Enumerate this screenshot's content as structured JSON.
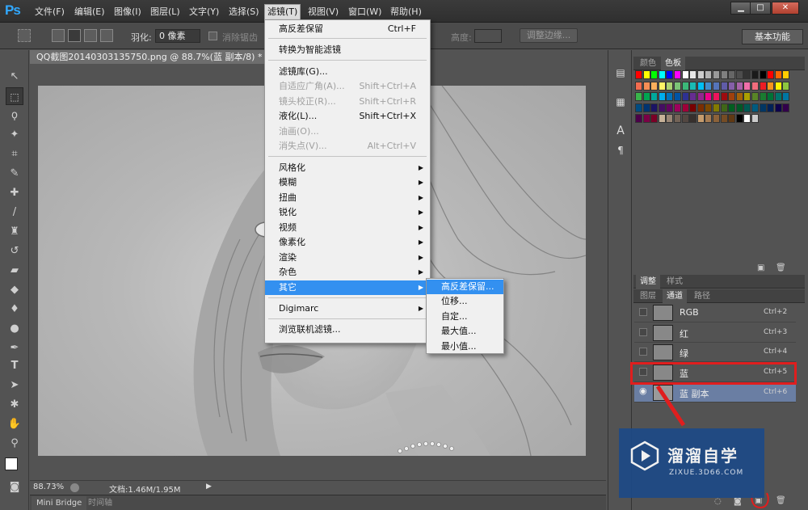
{
  "app": {
    "logo": "Ps",
    "menu": [
      {
        "label": "文件(F)"
      },
      {
        "label": "编辑(E)"
      },
      {
        "label": "图像(I)"
      },
      {
        "label": "图层(L)"
      },
      {
        "label": "文字(Y)"
      },
      {
        "label": "选择(S)"
      },
      {
        "label": "滤镜(T)"
      },
      {
        "label": "视图(V)"
      },
      {
        "label": "窗口(W)"
      },
      {
        "label": "帮助(H)"
      }
    ],
    "window_controls": {
      "minimize": "▁",
      "maximize": "□",
      "close": "✕"
    }
  },
  "options": {
    "feather_label": "羽化:",
    "feather_value": "0 像素",
    "antialias_label": "消除锯齿",
    "height_label": "高度:",
    "refine_edge_label": "调整边缘...",
    "workspace": "基本功能"
  },
  "document": {
    "tab_title": "QQ截图20140303135750.png @ 88.7%(蓝 副本/8) *",
    "tab_close": "×",
    "zoom": "88.73%",
    "doc_size": "文档:1.46M/1.95M"
  },
  "bottom_tabs": {
    "mini_bridge": "Mini Bridge",
    "timeline": "时间轴"
  },
  "filter_menu": {
    "items": [
      {
        "label": "高反差保留",
        "shortcut": "Ctrl+F"
      },
      {
        "label": "转换为智能滤镜"
      },
      {
        "label": "滤镜库(G)..."
      },
      {
        "label": "自适应广角(A)...",
        "shortcut": "Shift+Ctrl+A",
        "disabled": true
      },
      {
        "label": "镜头校正(R)...",
        "shortcut": "Shift+Ctrl+R",
        "disabled": true
      },
      {
        "label": "液化(L)...",
        "shortcut": "Shift+Ctrl+X"
      },
      {
        "label": "油画(O)...",
        "disabled": true
      },
      {
        "label": "消失点(V)...",
        "shortcut": "Alt+Ctrl+V",
        "disabled": true
      },
      {
        "label": "风格化"
      },
      {
        "label": "模糊"
      },
      {
        "label": "扭曲"
      },
      {
        "label": "锐化"
      },
      {
        "label": "视频"
      },
      {
        "label": "像素化"
      },
      {
        "label": "渲染"
      },
      {
        "label": "杂色"
      },
      {
        "label": "其它"
      },
      {
        "label": "Digimarc"
      },
      {
        "label": "浏览联机滤镜..."
      }
    ],
    "submenu": [
      "高反差保留...",
      "位移...",
      "自定...",
      "最大值...",
      "最小值..."
    ]
  },
  "panels": {
    "color_tabs": {
      "color": "颜色",
      "swatches": "色板"
    },
    "adjust_tabs": {
      "adjust": "调整",
      "styles": "样式"
    },
    "layer_tabs": {
      "layers": "图层",
      "channels": "通道",
      "paths": "路径"
    },
    "channels": [
      {
        "name": "RGB",
        "key": "Ctrl+2"
      },
      {
        "name": "红",
        "key": "Ctrl+3"
      },
      {
        "name": "绿",
        "key": "Ctrl+4"
      },
      {
        "name": "蓝",
        "key": "Ctrl+5"
      },
      {
        "name": "蓝 副本",
        "key": "Ctrl+6"
      }
    ],
    "swatch_colors": [
      [
        "#ff0000",
        "#ffff00",
        "#00ff00",
        "#00ffff",
        "#0000ff",
        "#ff00ff",
        "#ffffff",
        "#e6e6e6",
        "#cccccc",
        "#b3b3b3",
        "#999999",
        "#808080",
        "#666666",
        "#4d4d4d",
        "#333333",
        "#1a1a1a",
        "#000000",
        "#ff0000",
        "#ff6600",
        "#ffcc00"
      ],
      [
        "#f26c4f",
        "#f68e55",
        "#fbaf5c",
        "#fff467",
        "#acd372",
        "#7cc576",
        "#3bb878",
        "#1abbb4",
        "#00bff3",
        "#438ccb",
        "#5574b9",
        "#605ca8",
        "#855fa8",
        "#a763a8",
        "#f06ea9",
        "#f26d7d",
        "#ed1c24",
        "#f7941d",
        "#fff200",
        "#8dc63f"
      ],
      [
        "#39b54a",
        "#00a651",
        "#00a99d",
        "#00aeef",
        "#0072bc",
        "#0054a6",
        "#2e3192",
        "#662d91",
        "#92278f",
        "#ec008c",
        "#ed145b",
        "#9e0b0f",
        "#a0410d",
        "#a36209",
        "#aba000",
        "#598527",
        "#1a7b30",
        "#007236",
        "#00746b",
        "#0076a3"
      ],
      [
        "#004b80",
        "#003471",
        "#1b1464",
        "#440e62",
        "#630460",
        "#9e005d",
        "#9e0039",
        "#790000",
        "#7b2e00",
        "#7d4900",
        "#827b00",
        "#406618",
        "#005e20",
        "#005826",
        "#005952",
        "#005b7f",
        "#003663",
        "#002157",
        "#0d004c",
        "#32004b"
      ],
      [
        "#4b0049",
        "#7b0046",
        "#7a0026",
        "#c7b299",
        "#998675",
        "#736357",
        "#534741",
        "#37302d",
        "#c69c6d",
        "#a67c52",
        "#8c6239",
        "#754c24",
        "#603913",
        "#000000",
        "#ffffff",
        "#cccccc"
      ]
    ]
  },
  "watermark": {
    "brand": "溜溜自学",
    "url": "ZIXUE.3D66.COM"
  }
}
